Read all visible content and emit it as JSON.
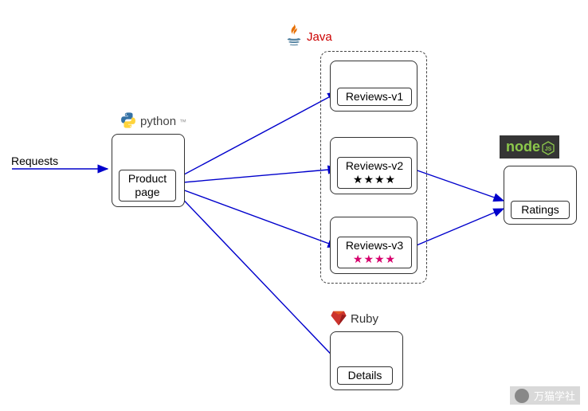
{
  "labels": {
    "requests": "Requests",
    "product_page": "Product page",
    "reviews_v1": "Reviews-v1",
    "reviews_v2": "Reviews-v2",
    "reviews_v3": "Reviews-v3",
    "ratings": "Ratings",
    "details": "Details"
  },
  "tech": {
    "python": "python",
    "java": "Java",
    "ruby": "Ruby",
    "node": "node"
  },
  "stars": {
    "v2": "★★★★",
    "v3": "★★★★"
  },
  "watermark": "万猫学社",
  "diagram": {
    "edges": [
      {
        "from": "Requests",
        "to": "Product page"
      },
      {
        "from": "Product page",
        "to": "Reviews-v1"
      },
      {
        "from": "Product page",
        "to": "Reviews-v2"
      },
      {
        "from": "Product page",
        "to": "Reviews-v3"
      },
      {
        "from": "Product page",
        "to": "Details"
      },
      {
        "from": "Reviews-v2",
        "to": "Ratings"
      },
      {
        "from": "Reviews-v3",
        "to": "Ratings"
      }
    ],
    "services": [
      {
        "name": "Product page",
        "tech": "python"
      },
      {
        "name": "Reviews-v1",
        "tech": "java",
        "stars": null
      },
      {
        "name": "Reviews-v2",
        "tech": "java",
        "stars": "black"
      },
      {
        "name": "Reviews-v3",
        "tech": "java",
        "stars": "red"
      },
      {
        "name": "Ratings",
        "tech": "node"
      },
      {
        "name": "Details",
        "tech": "ruby"
      }
    ]
  }
}
